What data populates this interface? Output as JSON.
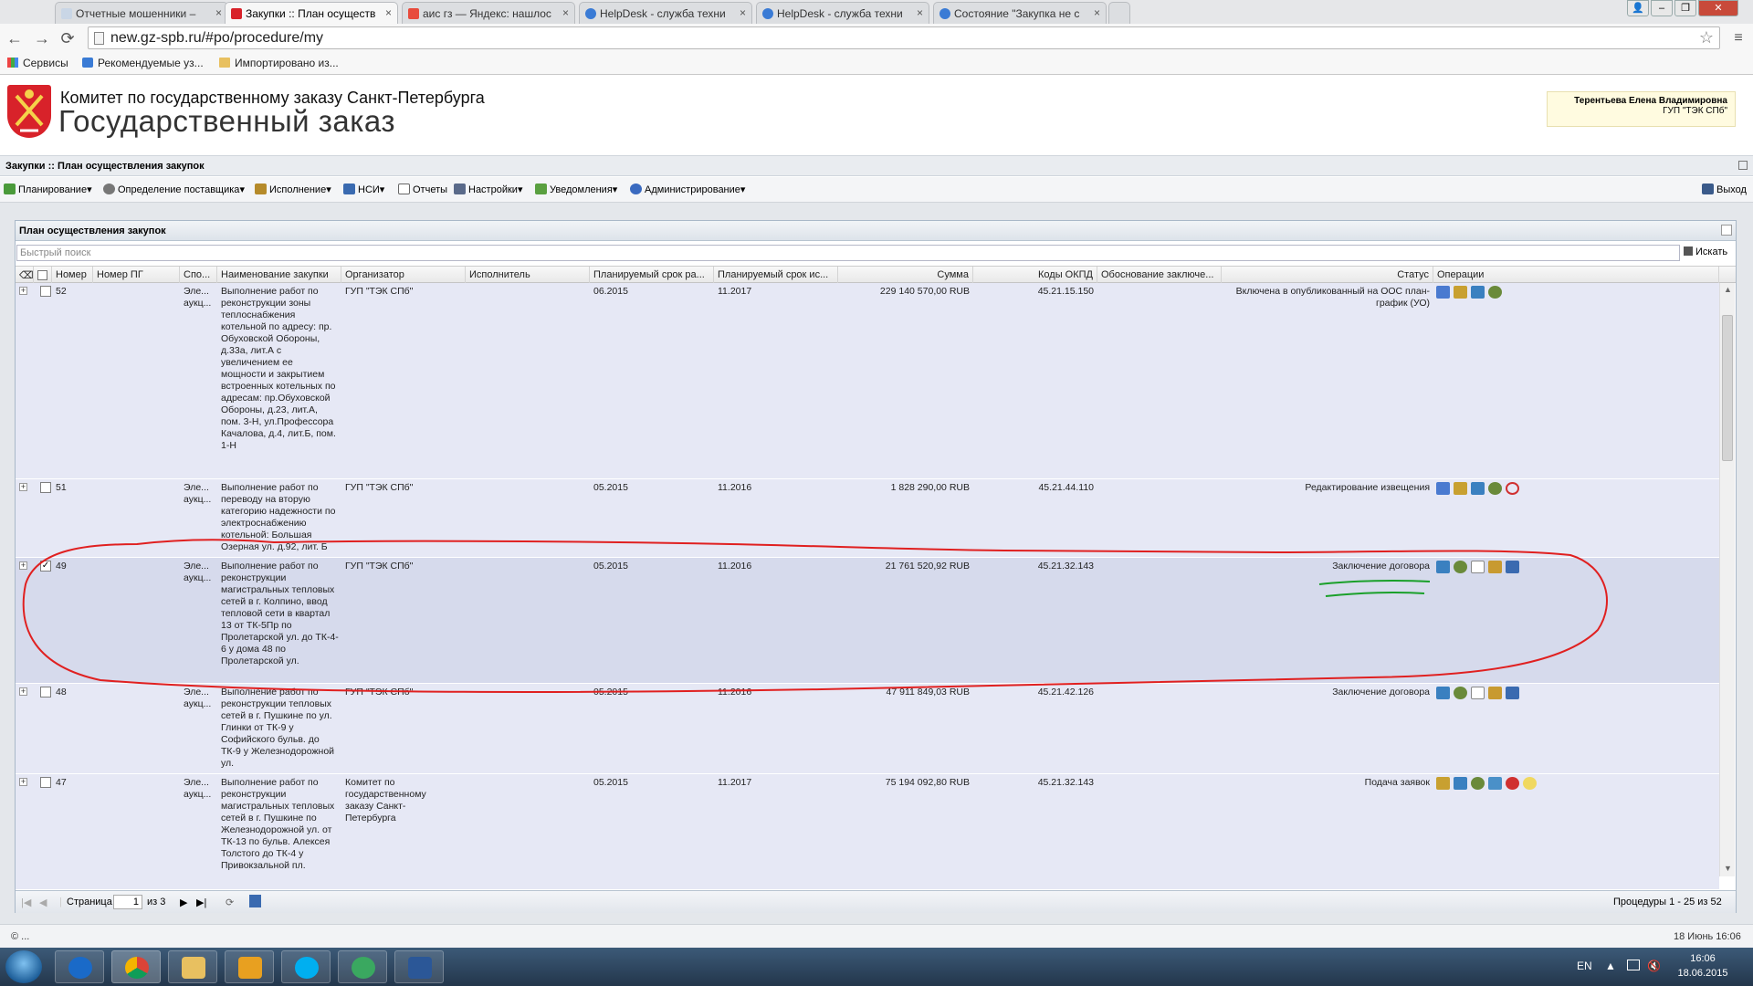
{
  "browser": {
    "tabs": [
      {
        "label": "Отчетные мошенники – ",
        "favicon_color": "#c9d6e6",
        "active": false
      },
      {
        "label": "Закупки :: План осуществ",
        "favicon_color": "#d8222a",
        "active": true
      },
      {
        "label": "аис гз — Яндекс: нашлос",
        "favicon_color": "#e84b3c",
        "active": false
      },
      {
        "label": "HelpDesk - служба техни",
        "favicon_color": "#3a7bd5",
        "active": false
      },
      {
        "label": "HelpDesk - служба техни",
        "favicon_color": "#3a7bd5",
        "active": false
      },
      {
        "label": "Состояние \"Закупка не с",
        "favicon_color": "#3a7bd5",
        "active": false
      }
    ],
    "url": "new.gz-spb.ru/#po/procedure/my",
    "bookmarks": [
      "Сервисы",
      "Рекомендуемые уз...",
      "Импортировано из..."
    ]
  },
  "header": {
    "org": "Комитет по государственному заказу Санкт-Петербурга",
    "title": "Государственный заказ",
    "user_name": "Терентьева Елена Владимировна",
    "user_org": "ГУП \"ТЭК СПб\""
  },
  "app": {
    "breadcrumb": "Закупки :: План осуществления закупок",
    "menu": [
      {
        "label": "Планирование",
        "icon": "calendar-icon",
        "color": "#4a9a3a"
      },
      {
        "label": "Определение поставщика",
        "icon": "gears-icon",
        "color": "#777777"
      },
      {
        "label": "Исполнение",
        "icon": "handshake-icon",
        "color": "#b58a2a"
      },
      {
        "label": "НСИ",
        "icon": "book-icon",
        "color": "#3a6ab0"
      },
      {
        "label": "Отчеты",
        "icon": "report-icon",
        "color": "#6a6a6a"
      },
      {
        "label": "Настройки",
        "icon": "wrench-icon",
        "color": "#5a6a8a"
      },
      {
        "label": "Уведомления",
        "icon": "envelope-icon",
        "color": "#5aa040"
      },
      {
        "label": "Администрирование",
        "icon": "user-icon",
        "color": "#3a6ac0"
      }
    ],
    "logout": "Выход"
  },
  "grid": {
    "title": "План осуществления закупок",
    "search_placeholder": "Быстрый поиск",
    "search_button": "Искать",
    "columns": [
      "Номер",
      "Номер ПГ",
      "Спо...",
      "Наименование закупки",
      "Организатор",
      "Исполнитель",
      "Планируемый срок ра...",
      "Планируемый срок ис...",
      "Сумма",
      "Коды ОКПД",
      "Обоснование заключе...",
      "Статус",
      "Операции"
    ],
    "rows": [
      {
        "num": "52",
        "method": "Эле... аукц...",
        "name": "Выполнение работ по реконструкции зоны теплоснабжения котельной по адресу: пр. Обуховской Обороны, д.33а, лит.А с увеличением ее мощности и закрытием встроенных котельных по адресам: пр.Обуховской Обороны, д.23, лит.А, пом. 3-Н, ул.Профессора Качалова, д.4, лит.Б, пом. 1-Н",
        "organizer": "ГУП \"ТЭК СПб\"",
        "start": "06.2015",
        "end": "11.2017",
        "sum": "229 140 570,00 RUB",
        "okpd": "45.21.15.150",
        "status": "Включена в опубликованный на ООС план-график (УО)",
        "checked": false,
        "ops": [
          "edit-icon",
          "publish-icon",
          "chart-icon",
          "gear-icon"
        ]
      },
      {
        "num": "51",
        "method": "Эле... аукц...",
        "name": "Выполнение работ по переводу на вторую категорию надежности по электроснабжению котельной: Большая Озерная ул. д.92, лит. Б",
        "organizer": "ГУП \"ТЭК СПб\"",
        "start": "05.2015",
        "end": "11.2016",
        "sum": "1 828 290,00 RUB",
        "okpd": "45.21.44.110",
        "status": "Редактирование извещения",
        "checked": false,
        "ops": [
          "edit-icon",
          "publish-icon",
          "chart-icon",
          "gear-icon",
          "refresh-icon"
        ]
      },
      {
        "num": "49",
        "method": "Эле... аукц...",
        "name": "Выполнение работ по реконструкции магистральных тепловых сетей в г. Колпино, ввод тепловой сети в квартал 13 от ТК-5Пр по Пролетарской ул. до ТК-4-6 у дома 48 по Пролетарской ул.",
        "organizer": "ГУП \"ТЭК СПб\"",
        "start": "05.2015",
        "end": "11.2016",
        "sum": "21 761 520,92 RUB",
        "okpd": "45.21.32.143",
        "status": "Заключение договора",
        "checked": true,
        "ops": [
          "chart-icon",
          "gear-icon",
          "document-icon",
          "emblem-icon",
          "save-icon"
        ]
      },
      {
        "num": "48",
        "method": "Эле... аукц...",
        "name": "Выполнение работ по реконструкции тепловых сетей в г. Пушкине по ул. Глинки от ТК-9 у Софийского бульв. до ТК-9 у Железнодорожной ул.",
        "organizer": "ГУП \"ТЭК СПб\"",
        "start": "05.2015",
        "end": "11.2016",
        "sum": "47 911 849,03 RUB",
        "okpd": "45.21.42.126",
        "status": "Заключение договора",
        "checked": false,
        "ops": [
          "chart-icon",
          "gear-icon",
          "document-icon",
          "emblem-icon",
          "save-icon"
        ]
      },
      {
        "num": "47",
        "method": "Эле... аукц...",
        "name": "Выполнение работ по реконструкции магистральных тепловых сетей в г. Пушкине по Железнодорожной ул. от ТК-13 по бульв. Алексея Толстого до ТК-4 у Привокзальной пл.",
        "organizer": "Комитет по государственному заказу Санкт-Петербурга",
        "start": "05.2015",
        "end": "11.2017",
        "sum": "75 194 092,80 RUB",
        "okpd": "45.21.32.143",
        "status": "Подача заявок",
        "checked": false,
        "ops": [
          "publish-icon",
          "chart-icon",
          "gear-icon",
          "image-icon",
          "stop-icon",
          "coins-icon"
        ]
      }
    ],
    "pager": {
      "page_label": "Страница",
      "page": "1",
      "of": "из 3",
      "summary": "Процедуры 1 - 25 из 52"
    }
  },
  "statusbar": {
    "left": "© ...",
    "right": "18 Июнь 16:06"
  },
  "taskbar": {
    "lang": "EN",
    "time": "16:06",
    "date": "18.06.2015"
  },
  "colors": {
    "annotation_red": "#e02020",
    "annotation_green": "#1aa02a",
    "row_bg": "#e6e8f5",
    "selected_row_bg": "#d6daec"
  }
}
